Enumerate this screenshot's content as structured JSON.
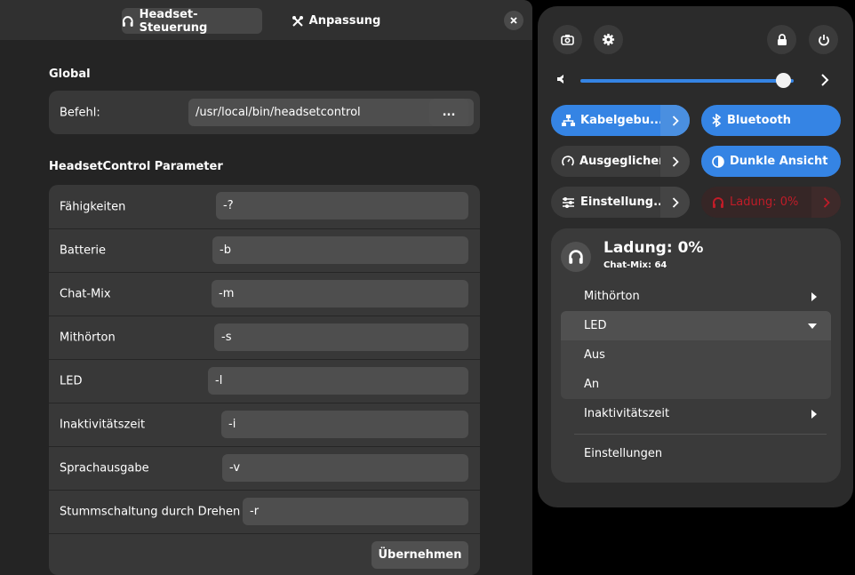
{
  "window": {
    "tabs": [
      {
        "label": "Headset-Steuerung",
        "icon": "headset-icon",
        "active": true
      },
      {
        "label": "Anpassung",
        "icon": "tools-icon",
        "active": false
      }
    ],
    "global": {
      "title": "Global",
      "command_label": "Befehl:",
      "command_value": "/usr/local/bin/headsetcontrol",
      "browse_label": "..."
    },
    "params": {
      "title": "HeadsetControl Parameter",
      "rows": [
        {
          "label": "Fähigkeiten",
          "value": "-?"
        },
        {
          "label": "Batterie",
          "value": "-b"
        },
        {
          "label": "Chat-Mix",
          "value": "-m"
        },
        {
          "label": "Mithörton",
          "value": "-s"
        },
        {
          "label": "LED",
          "value": "-l"
        },
        {
          "label": "Inaktivitätszeit",
          "value": "-i"
        },
        {
          "label": "Sprachausgabe",
          "value": "-v"
        },
        {
          "label": "Stummschaltung durch Drehen",
          "value": "-r"
        }
      ],
      "apply_label": "Übernehmen"
    }
  },
  "quick_settings": {
    "volume_level": 0.95,
    "toggles": [
      {
        "label": "Kabelgebu...",
        "icon": "wired-network-icon",
        "state": "on",
        "has_arrow": true
      },
      {
        "label": "Bluetooth",
        "icon": "bluetooth-icon",
        "state": "on",
        "has_arrow": false
      },
      {
        "label": "Ausgeglichen",
        "icon": "power-profile-icon",
        "state": "off",
        "has_arrow": true
      },
      {
        "label": "Dunkle Ansicht",
        "icon": "dark-mode-icon",
        "state": "on",
        "has_arrow": false
      },
      {
        "label": "Einstellung...",
        "icon": "settings-sliders-icon",
        "state": "off",
        "has_arrow": true
      },
      {
        "label": "Ladung: 0%",
        "icon": "headset-icon",
        "state": "alert",
        "has_arrow": true
      }
    ],
    "headset_menu": {
      "title": "Ladung: 0%",
      "subtitle": "Chat-Mix: 64",
      "items": [
        "Mithörton",
        "LED",
        "Aus",
        "An",
        "Inaktivitätszeit",
        "Einstellungen"
      ]
    }
  },
  "colors": {
    "accent": "#3584e4",
    "alert": "#c01c28",
    "window_bg": "#242424",
    "card_bg": "#383838"
  }
}
